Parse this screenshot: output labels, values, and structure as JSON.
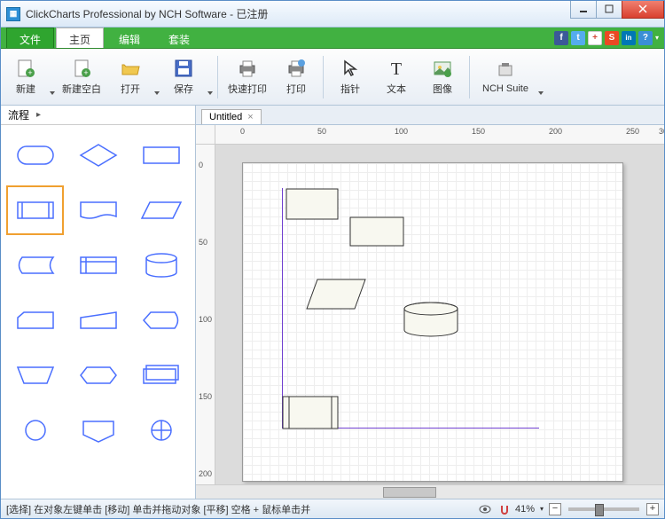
{
  "window": {
    "title": "ClickCharts Professional by NCH Software - 已注册"
  },
  "menus": {
    "file": "文件",
    "home": "主页",
    "edit": "编辑",
    "suite": "套装"
  },
  "social": [
    {
      "name": "facebook",
      "bg": "#3b5998",
      "txt": "f"
    },
    {
      "name": "twitter",
      "bg": "#55acee",
      "txt": "t"
    },
    {
      "name": "google",
      "bg": "#ffffff",
      "txt": "+"
    },
    {
      "name": "stumble",
      "bg": "#eb4924",
      "txt": "S"
    },
    {
      "name": "linkedin",
      "bg": "#0077b5",
      "txt": "in"
    },
    {
      "name": "help",
      "bg": "#3a8fd6",
      "txt": "?"
    }
  ],
  "toolbar": {
    "new": "新建",
    "newblank": "新建空白",
    "open": "打开",
    "save": "保存",
    "quickprint": "快速打印",
    "print": "打印",
    "pointer": "指针",
    "text": "文本",
    "image": "图像",
    "suite": "NCH Suite"
  },
  "sidebar": {
    "header": "流程"
  },
  "doc": {
    "tab": "Untitled"
  },
  "ruler_h": [
    "0",
    "50",
    "100",
    "150",
    "200",
    "250",
    "30"
  ],
  "ruler_v": [
    "0",
    "50",
    "100",
    "150",
    "200"
  ],
  "status": {
    "text": "[选择] 在对象左键单击 [移动] 单击并拖动对象 [平移] 空格 + 鼠标单击并",
    "zoom": "41%"
  }
}
